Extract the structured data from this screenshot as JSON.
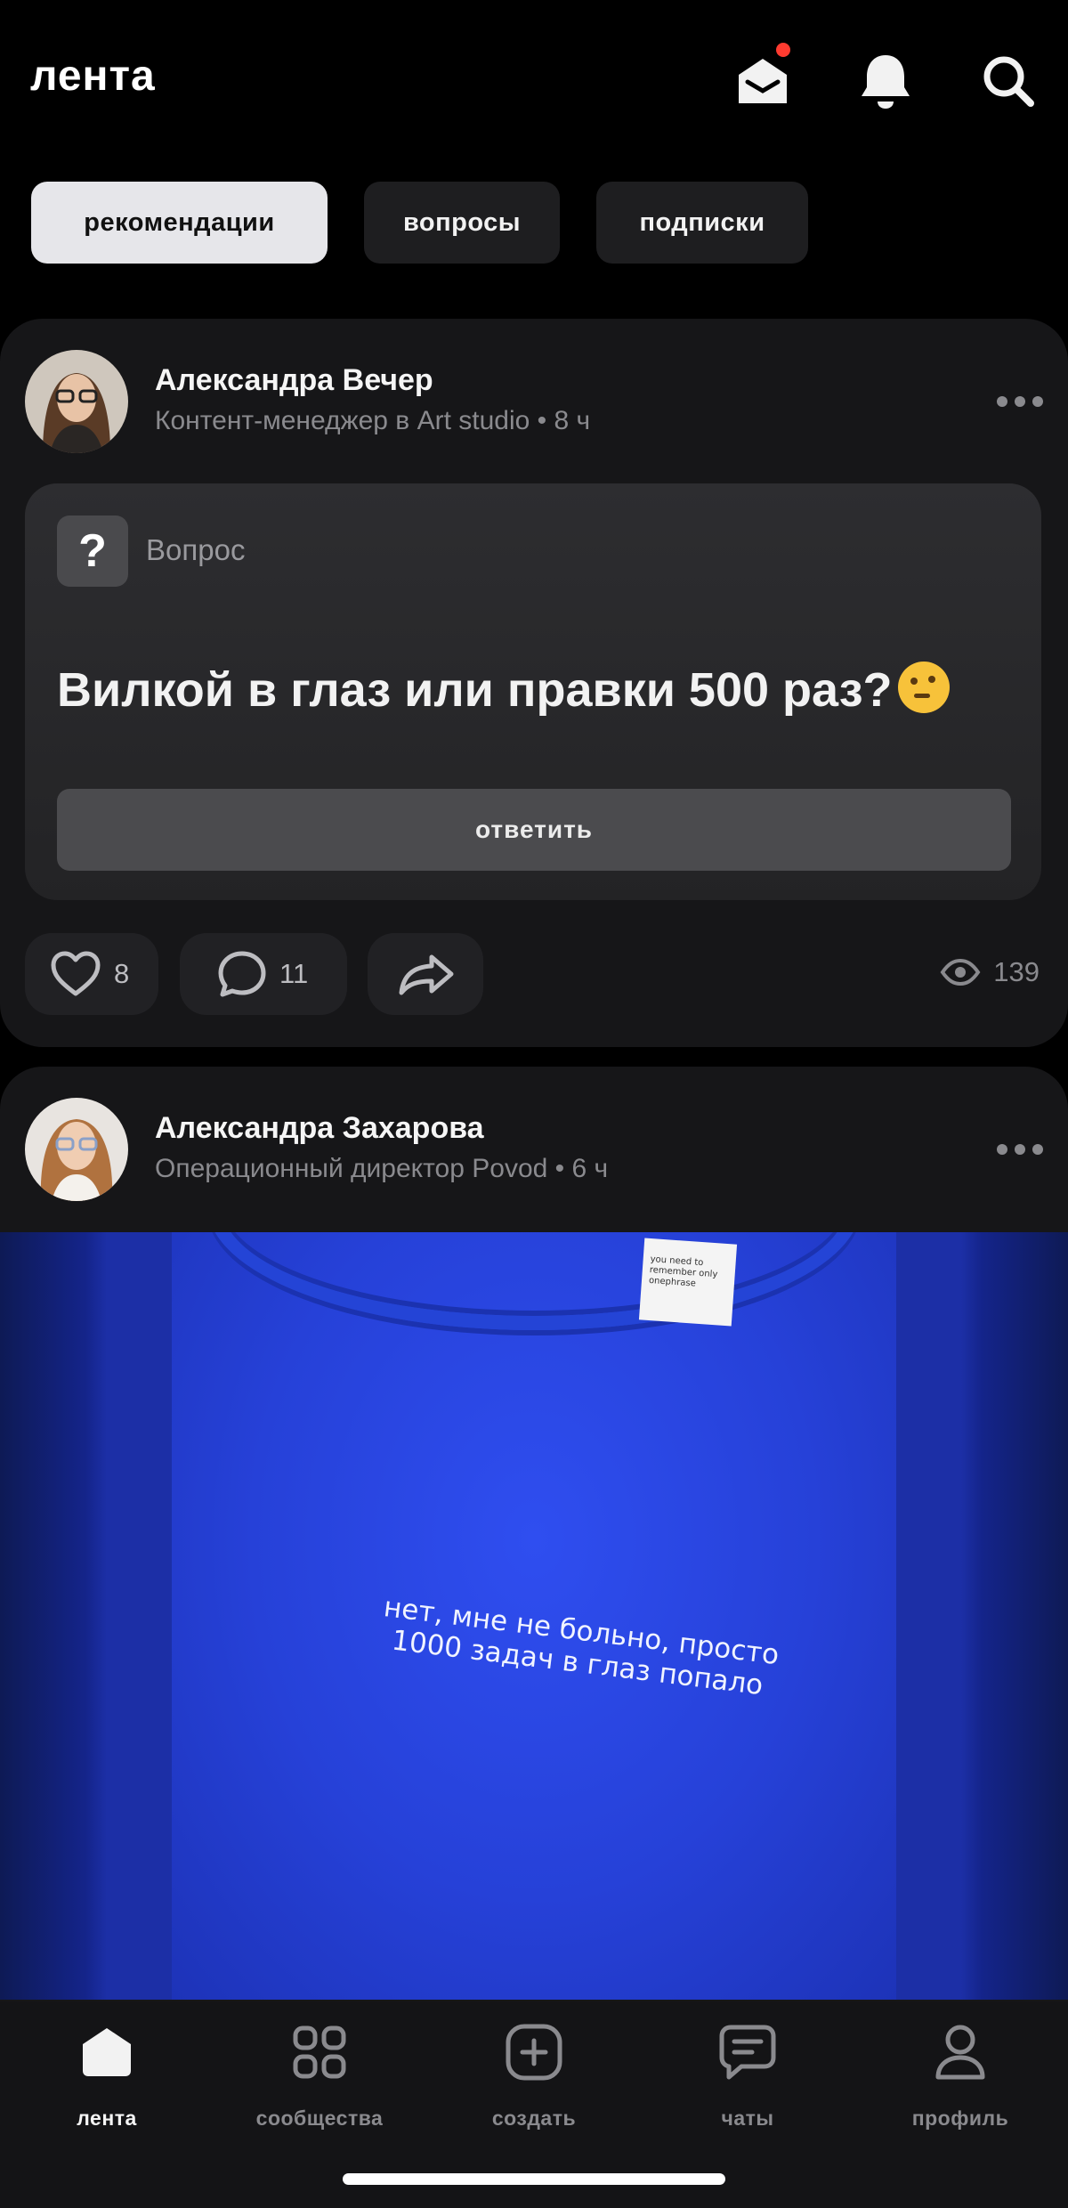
{
  "header": {
    "title": "лента",
    "icons": [
      "mail-icon",
      "bell-icon",
      "search-icon"
    ]
  },
  "tabs": [
    {
      "label": "рекомендации",
      "active": true
    },
    {
      "label": "вопросы",
      "active": false
    },
    {
      "label": "подписки",
      "active": false
    }
  ],
  "posts": [
    {
      "author": "Александра Вечер",
      "meta": "Контент-менеджер в Art studio • 8 ч",
      "question_label": "Вопрос",
      "question_text": "Вилкой в глаз или правки 500 раз?",
      "question_emoji": "thinking-face",
      "answer_label": "ответить",
      "likes": "8",
      "comments": "11",
      "views": "139"
    },
    {
      "author": "Александра Захарова",
      "meta": "Операционный директор Povod • 6 ч",
      "image": {
        "tag_text": "you need to remember only onephrase",
        "print_line1": "нет, мне не больно, просто",
        "print_line2": "1000 задач в глаз попало"
      }
    }
  ],
  "nav": [
    {
      "label": "лента",
      "icon": "home-icon",
      "active": true
    },
    {
      "label": "сообщества",
      "icon": "grid-icon",
      "active": false
    },
    {
      "label": "создать",
      "icon": "plus-square-icon",
      "active": false
    },
    {
      "label": "чаты",
      "icon": "chat-icon",
      "active": false
    },
    {
      "label": "профиль",
      "icon": "profile-icon",
      "active": false
    }
  ],
  "colors": {
    "background": "#000000",
    "card": "#161618",
    "active_tab": "#e6e6ea",
    "notification_dot": "#ff3b30",
    "shirt_blue": "#2641d8"
  }
}
